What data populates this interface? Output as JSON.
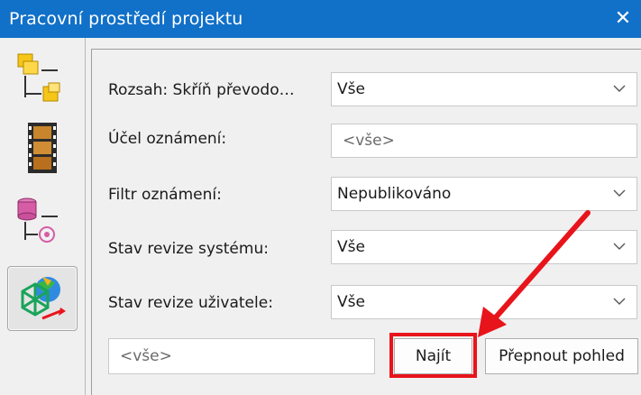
{
  "window": {
    "title": "Pracovní prostředí projektu",
    "close_glyph": "✕"
  },
  "sidebar": {
    "items": [
      {
        "icon": "tree-structure-icon"
      },
      {
        "icon": "film-strip-icon"
      },
      {
        "icon": "database-icon"
      },
      {
        "icon": "globe-network-icon"
      }
    ],
    "active_index": 3
  },
  "filters": {
    "scope": {
      "label": "Rozsah: Skříň převodo…",
      "value": "Vše"
    },
    "purpose": {
      "label": "Účel oznámení:",
      "placeholder": "<vše>"
    },
    "filter": {
      "label": "Filtr oznámení:",
      "value": "Nepublikováno"
    },
    "system_revision": {
      "label": "Stav revize systému:",
      "value": "Vše"
    },
    "user_revision": {
      "label": "Stav revize uživatele:",
      "value": "Vše"
    }
  },
  "search": {
    "placeholder": "<vše>",
    "find_label": "Najít",
    "switch_view_label": "Přepnout pohled"
  },
  "annotation": {
    "color": "#e8141b"
  }
}
